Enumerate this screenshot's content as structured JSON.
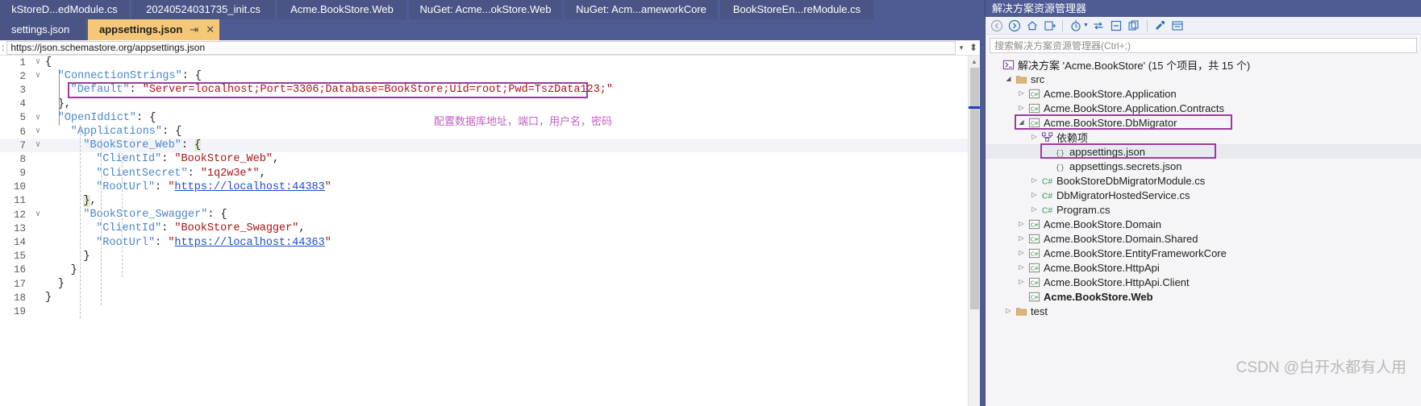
{
  "tabs_row1": [
    {
      "label": "kStoreD...edModule.cs"
    },
    {
      "label": "20240524031735_init.cs"
    },
    {
      "label": "Acme.BookStore.Web"
    },
    {
      "label": "NuGet: Acme...okStore.Web"
    },
    {
      "label": "NuGet: Acm...ameworkCore"
    },
    {
      "label": "BookStoreEn...reModule.cs"
    }
  ],
  "tabs_row2": [
    {
      "label": "settings.json",
      "active": false
    },
    {
      "label": "appsettings.json",
      "active": true,
      "pin": "⇥",
      "close": "✕"
    }
  ],
  "schema_bar": {
    "label": ":",
    "url": "https://json.schemastore.org/appsettings.json",
    "caret": "▾",
    "split_icon": "⬍"
  },
  "code": {
    "lines": [
      {
        "n": "1",
        "fold": "∨",
        "indent": 0,
        "segs": [
          {
            "t": "{",
            "c": "k-punc"
          }
        ]
      },
      {
        "n": "2",
        "fold": "∨",
        "indent": 1,
        "segs": [
          {
            "t": "\"ConnectionStrings\"",
            "c": "k-prop"
          },
          {
            "t": ": {",
            "c": "k-punc"
          }
        ]
      },
      {
        "n": "3",
        "fold": "",
        "indent": 2,
        "segs": [
          {
            "t": "\"Default\"",
            "c": "k-prop"
          },
          {
            "t": ": ",
            "c": "k-punc"
          },
          {
            "t": "\"Server=localhost;Port=3306;Database=BookStore;Uid=root;Pwd=TszData123;\"",
            "c": "k-str"
          }
        ]
      },
      {
        "n": "4",
        "fold": "",
        "indent": 1,
        "segs": [
          {
            "t": "},",
            "c": "k-punc"
          }
        ]
      },
      {
        "n": "5",
        "fold": "∨",
        "indent": 1,
        "segs": [
          {
            "t": "\"OpenIddict\"",
            "c": "k-prop"
          },
          {
            "t": ": {",
            "c": "k-punc"
          }
        ]
      },
      {
        "n": "6",
        "fold": "∨",
        "indent": 2,
        "segs": [
          {
            "t": "\"Applications\"",
            "c": "k-prop"
          },
          {
            "t": ": {",
            "c": "k-punc"
          }
        ]
      },
      {
        "n": "7",
        "fold": "∨",
        "indent": 3,
        "segs": [
          {
            "t": "\"BookStore_Web\"",
            "c": "k-prop"
          },
          {
            "t": ": ",
            "c": "k-punc"
          },
          {
            "t": "{",
            "c": "brace-hl"
          }
        ]
      },
      {
        "n": "8",
        "fold": "",
        "indent": 4,
        "segs": [
          {
            "t": "\"ClientId\"",
            "c": "k-prop"
          },
          {
            "t": ": ",
            "c": "k-punc"
          },
          {
            "t": "\"BookStore_Web\"",
            "c": "k-str"
          },
          {
            "t": ",",
            "c": "k-punc"
          }
        ]
      },
      {
        "n": "9",
        "fold": "",
        "indent": 4,
        "segs": [
          {
            "t": "\"ClientSecret\"",
            "c": "k-prop"
          },
          {
            "t": ": ",
            "c": "k-punc"
          },
          {
            "t": "\"1q2w3e*\"",
            "c": "k-str"
          },
          {
            "t": ",",
            "c": "k-punc"
          }
        ]
      },
      {
        "n": "10",
        "fold": "",
        "indent": 4,
        "segs": [
          {
            "t": "\"RootUrl\"",
            "c": "k-prop"
          },
          {
            "t": ": ",
            "c": "k-punc"
          },
          {
            "t": "\"",
            "c": "k-str"
          },
          {
            "t": "https://localhost:44383",
            "c": "k-link"
          },
          {
            "t": "\"",
            "c": "k-str"
          }
        ]
      },
      {
        "n": "11",
        "fold": "",
        "indent": 3,
        "segs": [
          {
            "t": "}",
            "c": "brace-hl"
          },
          {
            "t": ",",
            "c": "k-punc"
          }
        ]
      },
      {
        "n": "12",
        "fold": "∨",
        "indent": 3,
        "segs": [
          {
            "t": "\"BookStore_Swagger\"",
            "c": "k-prop"
          },
          {
            "t": ": {",
            "c": "k-punc"
          }
        ]
      },
      {
        "n": "13",
        "fold": "",
        "indent": 4,
        "segs": [
          {
            "t": "\"ClientId\"",
            "c": "k-prop"
          },
          {
            "t": ": ",
            "c": "k-punc"
          },
          {
            "t": "\"BookStore_Swagger\"",
            "c": "k-str"
          },
          {
            "t": ",",
            "c": "k-punc"
          }
        ]
      },
      {
        "n": "14",
        "fold": "",
        "indent": 4,
        "segs": [
          {
            "t": "\"RootUrl\"",
            "c": "k-prop"
          },
          {
            "t": ": ",
            "c": "k-punc"
          },
          {
            "t": "\"",
            "c": "k-str"
          },
          {
            "t": "https://localhost:44363",
            "c": "k-link"
          },
          {
            "t": "\"",
            "c": "k-str"
          }
        ]
      },
      {
        "n": "15",
        "fold": "",
        "indent": 3,
        "segs": [
          {
            "t": "}",
            "c": "k-punc"
          }
        ]
      },
      {
        "n": "16",
        "fold": "",
        "indent": 2,
        "segs": [
          {
            "t": "}",
            "c": "k-punc"
          }
        ]
      },
      {
        "n": "17",
        "fold": "",
        "indent": 1,
        "segs": [
          {
            "t": "}",
            "c": "k-punc"
          }
        ]
      },
      {
        "n": "18",
        "fold": "",
        "indent": 0,
        "segs": [
          {
            "t": "}",
            "c": "k-punc"
          }
        ]
      },
      {
        "n": "19",
        "fold": "",
        "indent": 0,
        "segs": []
      }
    ]
  },
  "annotation": {
    "text": "配置数据库地址，端口，用户名，密码",
    "color": "#c060c0"
  },
  "highlight_color": "#9b3b9b",
  "solution_explorer": {
    "title": "解决方案资源管理器",
    "search_placeholder": "搜索解决方案资源管理器(Ctrl+;)",
    "toolbar": [
      {
        "name": "back-icon",
        "glyph": "←"
      },
      {
        "name": "forward-icon",
        "glyph": "→"
      },
      {
        "name": "home-icon",
        "glyph": "⌂"
      },
      {
        "name": "sync-with-active-document-icon",
        "glyph": "⇲"
      },
      {
        "name": "pending-changes-icon",
        "glyph": "◔"
      },
      {
        "name": "refresh-icon",
        "glyph": "⇆"
      },
      {
        "name": "collapse-all-icon",
        "glyph": "⊟"
      },
      {
        "name": "show-all-files-icon",
        "glyph": "⧉"
      },
      {
        "name": "properties-icon",
        "glyph": "🔧"
      },
      {
        "name": "preview-selected-items-icon",
        "glyph": "☰"
      }
    ],
    "tree": [
      {
        "id": "solution",
        "depth": 0,
        "tw": "",
        "icon": "solution",
        "label": "解决方案 'Acme.BookStore' (15 个项目，共 15 个)",
        "bold": false,
        "sel": false
      },
      {
        "id": "src",
        "depth": 1,
        "tw": "◢",
        "icon": "folder",
        "label": "src",
        "bold": false,
        "sel": false
      },
      {
        "id": "application",
        "depth": 2,
        "tw": "▷",
        "icon": "csproj",
        "label": "Acme.BookStore.Application",
        "bold": false,
        "sel": false
      },
      {
        "id": "app-contracts",
        "depth": 2,
        "tw": "▷",
        "icon": "csproj",
        "label": "Acme.BookStore.Application.Contracts",
        "bold": false,
        "sel": false
      },
      {
        "id": "dbmigrator",
        "depth": 2,
        "tw": "◢",
        "icon": "csproj",
        "label": "Acme.BookStore.DbMigrator",
        "bold": false,
        "sel": false,
        "boxed": true
      },
      {
        "id": "dependencies",
        "depth": 3,
        "tw": "▷",
        "icon": "deps",
        "label": "依赖项",
        "bold": false,
        "sel": false
      },
      {
        "id": "appsettings",
        "depth": 4,
        "tw": "",
        "icon": "json",
        "label": "appsettings.json",
        "bold": false,
        "sel": true,
        "boxed": true
      },
      {
        "id": "appsecrets",
        "depth": 4,
        "tw": "",
        "icon": "json",
        "label": "appsettings.secrets.json",
        "bold": false,
        "sel": false
      },
      {
        "id": "dbmigmodule",
        "depth": 3,
        "tw": "▷",
        "icon": "cs",
        "label": "BookStoreDbMigratorModule.cs",
        "bold": false,
        "sel": false
      },
      {
        "id": "hostedservice",
        "depth": 3,
        "tw": "▷",
        "icon": "cs",
        "label": "DbMigratorHostedService.cs",
        "bold": false,
        "sel": false
      },
      {
        "id": "program",
        "depth": 3,
        "tw": "▷",
        "icon": "cs",
        "label": "Program.cs",
        "bold": false,
        "sel": false
      },
      {
        "id": "domain",
        "depth": 2,
        "tw": "▷",
        "icon": "csproj",
        "label": "Acme.BookStore.Domain",
        "bold": false,
        "sel": false
      },
      {
        "id": "domainshared",
        "depth": 2,
        "tw": "▷",
        "icon": "csproj",
        "label": "Acme.BookStore.Domain.Shared",
        "bold": false,
        "sel": false
      },
      {
        "id": "efcore",
        "depth": 2,
        "tw": "▷",
        "icon": "csproj",
        "label": "Acme.BookStore.EntityFrameworkCore",
        "bold": false,
        "sel": false
      },
      {
        "id": "httpapi",
        "depth": 2,
        "tw": "▷",
        "icon": "csproj",
        "label": "Acme.BookStore.HttpApi",
        "bold": false,
        "sel": false
      },
      {
        "id": "httpapiclient",
        "depth": 2,
        "tw": "▷",
        "icon": "csproj",
        "label": "Acme.BookStore.HttpApi.Client",
        "bold": false,
        "sel": false
      },
      {
        "id": "web",
        "depth": 2,
        "tw": "",
        "icon": "csproj-startup",
        "label": "Acme.BookStore.Web",
        "bold": true,
        "sel": false
      },
      {
        "id": "test",
        "depth": 1,
        "tw": "▷",
        "icon": "folder",
        "label": "test",
        "bold": false,
        "sel": false
      }
    ]
  },
  "watermark": "CSDN @白开水都有人用"
}
